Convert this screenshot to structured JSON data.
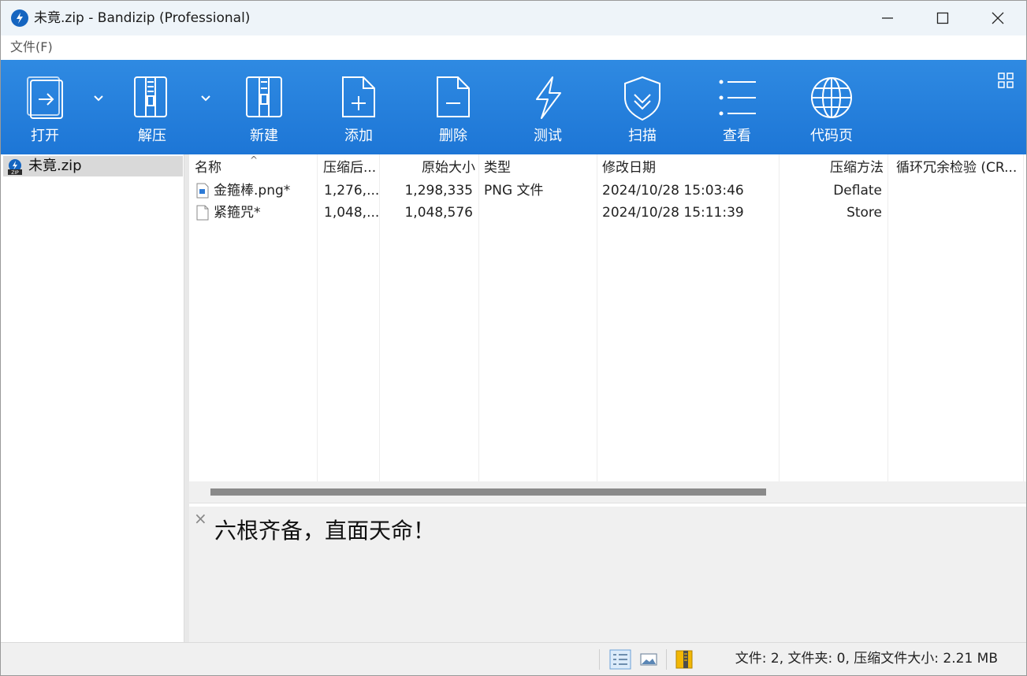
{
  "window": {
    "title": "未竟.zip - Bandizip (Professional)"
  },
  "menu": {
    "file": "文件(F)"
  },
  "toolbar": {
    "open": "打开",
    "extract": "解压",
    "new": "新建",
    "add": "添加",
    "delete": "删除",
    "test": "测试",
    "scan": "扫描",
    "view": "查看",
    "codepage": "代码页"
  },
  "tree": {
    "archive": "未竟.zip"
  },
  "columns": {
    "name": "名称",
    "compressed": "压缩后...",
    "original": "原始大小",
    "type": "类型",
    "modified": "修改日期",
    "method": "压缩方法",
    "crc": "循环冗余检验 (CR..."
  },
  "files": [
    {
      "name": "金箍棒.png*",
      "compressed": "1,276,...",
      "original": "1,298,335",
      "type": "PNG 文件",
      "modified": "2024/10/28 15:03:46",
      "method": "Deflate"
    },
    {
      "name": "紧箍咒*",
      "compressed": "1,048,...",
      "original": "1,048,576",
      "type": "",
      "modified": "2024/10/28 15:11:39",
      "method": "Store"
    }
  ],
  "comment": {
    "close": "×",
    "text": "六根齐备，直面天命！"
  },
  "status": {
    "text": "文件: 2, 文件夹: 0, 压缩文件大小: 2.21 MB"
  },
  "colors": {
    "toolbar": "#1d76d6",
    "accent": "#1565c0"
  }
}
